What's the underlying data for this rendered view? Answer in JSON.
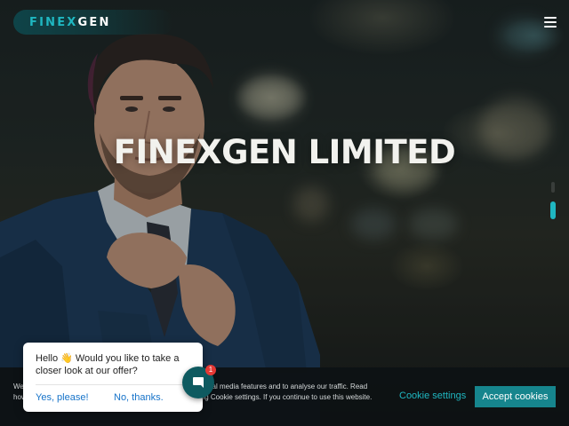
{
  "header": {
    "logo_part1": "FINEX",
    "logo_part2": "GEN",
    "menu_icon": "hamburger-menu-icon"
  },
  "hero": {
    "title": "FINEXGEN LIMITED",
    "slides": 2,
    "active_slide": 2
  },
  "cookie_banner": {
    "text": "We use cookies to personalise content and ads, to provide social media features and to analyse our traffic. Read how we use cookies and how you can control them by clicking Cookie settings. If you continue to use this website.",
    "settings_label": "Cookie settings",
    "accept_label": "Accept cookies"
  },
  "chat": {
    "message": "Hello 👋 Would you like to take a closer look at our offer?",
    "yes_label": "Yes, please!",
    "no_label": "No, thanks.",
    "badge_count": "1",
    "launcher_icon": "chat-bubble-icon"
  },
  "colors": {
    "accent": "#1fb7c1",
    "button": "#16858d",
    "badge": "#e53935"
  }
}
